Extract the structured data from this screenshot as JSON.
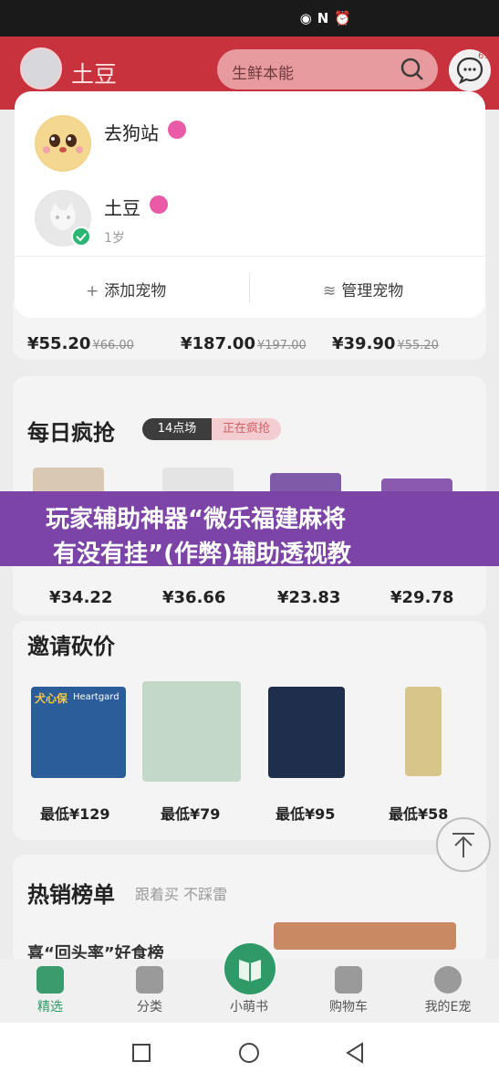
{
  "header": {
    "pet_name": "土豆",
    "search_placeholder": "生鲜本能",
    "message_badge": "61"
  },
  "pet_menu": {
    "pets": [
      {
        "name": "去狗站",
        "age": ""
      },
      {
        "name": "土豆",
        "age": "1岁"
      }
    ],
    "add_label": "添加宠物",
    "manage_label": "管理宠物"
  },
  "top_prices": [
    {
      "price": "¥55.20",
      "old": "¥66.00"
    },
    {
      "price": "¥187.00",
      "old": "¥197.00"
    },
    {
      "price": "¥39.90",
      "old": "¥55.20"
    }
  ],
  "flash_sale": {
    "title": "每日疯抢",
    "time_tag": "14点场",
    "status_tag": "正在疯抢",
    "prices": [
      "¥34.22",
      "¥36.66",
      "¥23.83",
      "¥29.78"
    ]
  },
  "banner": {
    "line1": "玩家辅助神器“微乐福建麻将",
    "line2": "有没有挂”(作弊)辅助透视教"
  },
  "bargain": {
    "title": "邀请砍价",
    "product_label": "犬心保",
    "product_label2": "Heartgard",
    "items": [
      "最低¥129",
      "最低¥79",
      "最低¥95",
      "最低¥58"
    ]
  },
  "hot_list": {
    "title": "热销榜单",
    "subtitle": "跟着买 不踩雷",
    "item_caption": "喜“回头率”好食榜"
  },
  "tabbar": {
    "items": [
      "精选",
      "分类",
      "小萌书",
      "购物车",
      "我的E宠"
    ]
  },
  "colors": {
    "header_red": "#c8323c",
    "accent_green": "#2f9a67",
    "banner_purple": "#7c44a6",
    "pet_flag_pink": "#e95ba6"
  }
}
